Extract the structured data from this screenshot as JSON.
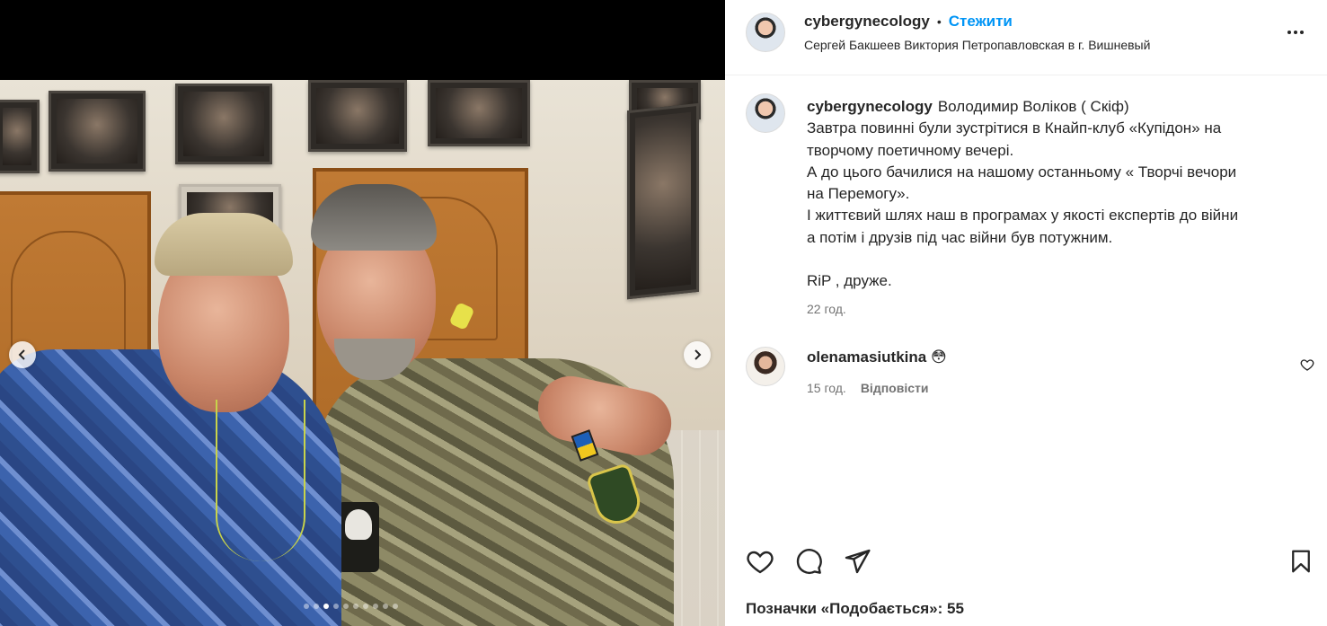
{
  "post": {
    "author": "cybergynecology",
    "follow_label": "Стежити",
    "separator": "•",
    "location": "Сергей Бакшеев Виктория Петропавловская в г. Вишневый"
  },
  "caption": {
    "author": "cybergynecology",
    "lines": [
      "Володимир Воліков ( Скіф)",
      "Завтра повинні були зустрітися в Кнайп-клуб «Купідон» на",
      "творчому поетичному вечері.",
      "А до цього бачилися на нашому останньому « Творчі вечори",
      "на Перемогу».",
      "І життєвий шлях наш в програмах у якості експертів до війни",
      "а потім і друзів під час війни був потужним.",
      "",
      "RiP , друже."
    ],
    "time": "22 год."
  },
  "comment": {
    "author": "olenamasiutkina",
    "text": "😳",
    "time": "15 год.",
    "reply_label": "Відповісти"
  },
  "likes": {
    "label": "Позначки «Подобається»: 55"
  },
  "carousel": {
    "dot_count": 10,
    "active_index": 2
  },
  "icons": {
    "more": "more-options-icon",
    "like": "heart-icon",
    "comment": "comment-icon",
    "share": "send-icon",
    "save": "bookmark-icon",
    "prev": "chevron-left-icon",
    "next": "chevron-right-icon"
  },
  "colors": {
    "follow": "#0095f6",
    "text": "#262626",
    "secondary": "#737373"
  }
}
